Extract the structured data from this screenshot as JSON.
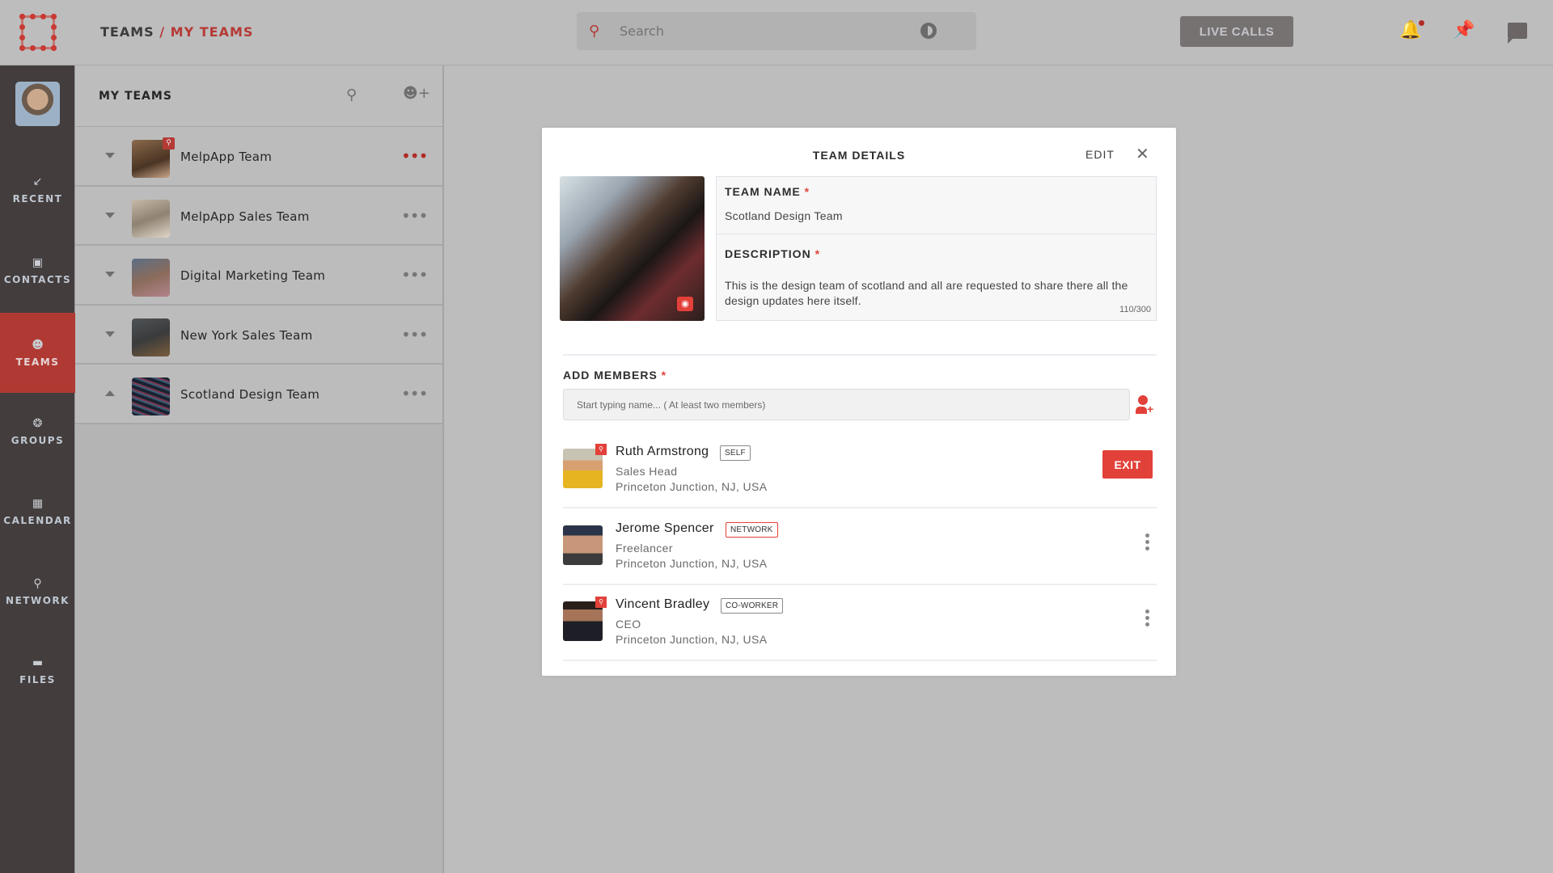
{
  "app": {
    "breadcrumb": {
      "root": "TEAMS",
      "separator": "/",
      "current": "MY TEAMS"
    },
    "search_placeholder": "Search",
    "live_calls_label": "LIVE CALLS",
    "notification_unread": true
  },
  "rail": {
    "items": [
      {
        "label": "RECENT",
        "icon": "recent-arrow-icon",
        "glyph": "↙",
        "active": false
      },
      {
        "label": "CONTACTS",
        "icon": "contacts-book-icon",
        "glyph": "▣",
        "active": false
      },
      {
        "label": "TEAMS",
        "icon": "teams-icon",
        "glyph": "👥",
        "active": true
      },
      {
        "label": "GROUPS",
        "icon": "groups-icon",
        "glyph": "❂",
        "active": false
      },
      {
        "label": "CALENDAR",
        "icon": "calendar-icon",
        "glyph": "▦",
        "active": false
      },
      {
        "label": "NETWORK",
        "icon": "network-icon",
        "glyph": "⚲",
        "active": false
      },
      {
        "label": "FILES",
        "icon": "folder-icon",
        "glyph": "▬",
        "active": false
      }
    ]
  },
  "teams_panel": {
    "title": "MY TEAMS",
    "teams": [
      {
        "name": "MelpApp Team",
        "expanded": false,
        "admin": true,
        "menu_highlight": true
      },
      {
        "name": "MelpApp Sales Team",
        "expanded": false,
        "admin": false,
        "menu_highlight": false
      },
      {
        "name": "Digital Marketing Team",
        "expanded": false,
        "admin": false,
        "menu_highlight": false
      },
      {
        "name": "New York Sales Team",
        "expanded": false,
        "admin": false,
        "menu_highlight": false
      },
      {
        "name": "Scotland Design Team",
        "expanded": true,
        "admin": false,
        "menu_highlight": false
      }
    ]
  },
  "modal": {
    "title": "TEAM DETAILS",
    "edit_label": "EDIT",
    "team_name_label": "TEAM NAME",
    "team_name_value": "Scotland Design Team",
    "description_label": "DESCRIPTION",
    "description_value": "This is the design team of scotland and all are requested to share there all the design updates here itself.",
    "char_count": "110/300",
    "required_mark": "*",
    "add_members_label": "ADD MEMBERS",
    "add_members_placeholder": "Start typing name... ( At least two members)",
    "members": [
      {
        "name": "Ruth Armstrong",
        "badge": "SELF",
        "role": "Sales Head",
        "location": "Princeton Junction, NJ, USA",
        "admin": true,
        "action": "EXIT"
      },
      {
        "name": "Jerome Spencer",
        "badge": "NETWORK",
        "role": "Freelancer",
        "location": "Princeton Junction, NJ, USA",
        "admin": false,
        "action": "menu"
      },
      {
        "name": "Vincent Bradley",
        "badge": "CO-WORKER",
        "role": "CEO",
        "location": "Princeton Junction, NJ, USA",
        "admin": true,
        "action": "menu"
      }
    ]
  },
  "colors": {
    "accent": "#e2413a",
    "accent_dimmed": "#b03a33",
    "rail_bg": "#433d3d",
    "overlay_bg": "#bdbdbd"
  }
}
